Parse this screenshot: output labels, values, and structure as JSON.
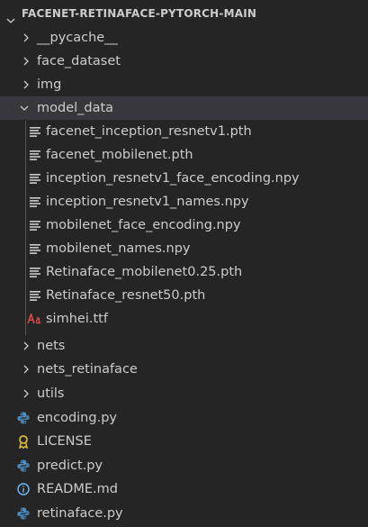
{
  "project_title": "FACENET-RETINAFACE-PYTORCH-MAIN",
  "colors": {
    "background": "#252526",
    "text": "#cccccc",
    "selected_row": "#37373d",
    "python_icon": "#4b8bbe",
    "license_icon": "#d7ba3b",
    "readme_icon": "#75beff",
    "font_icon": "#e0494c"
  },
  "tree": {
    "pycache": "__pycache__",
    "face_dataset": "face_dataset",
    "img": "img",
    "model_data": "model_data",
    "model_files": [
      "facenet_inception_resnetv1.pth",
      "facenet_mobilenet.pth",
      "inception_resnetv1_face_encoding.npy",
      "inception_resnetv1_names.npy",
      "mobilenet_face_encoding.npy",
      "mobilenet_names.npy",
      "Retinaface_mobilenet0.25.pth",
      "Retinaface_resnet50.pth"
    ],
    "font_file": "simhei.ttf",
    "nets": "nets",
    "nets_retinaface": "nets_retinaface",
    "utils": "utils",
    "encoding": "encoding.py",
    "license": "LICENSE",
    "predict": "predict.py",
    "readme": "README.md",
    "retinaface": "retinaface.py"
  }
}
